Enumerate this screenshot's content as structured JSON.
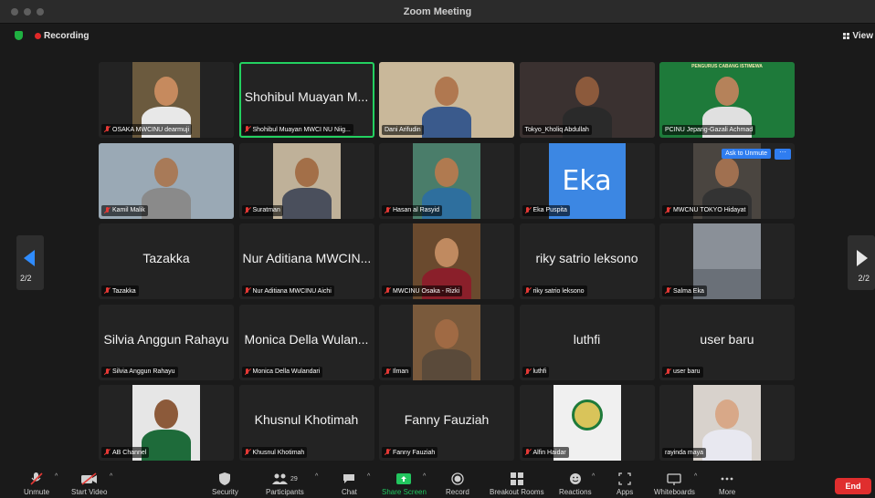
{
  "window": {
    "title": "Zoom Meeting"
  },
  "topbar": {
    "recording_label": "Recording",
    "view_label": "View"
  },
  "pagination": {
    "left": "2/2",
    "right": "2/2"
  },
  "tiles": [
    {
      "big_name": "",
      "label": "OSAKA MWCINU dearmuji",
      "muted": true,
      "video": "person",
      "bg": "#6b5a3e",
      "skin": "#c68a5e",
      "shirt": "#e8e8e8"
    },
    {
      "big_name": "Shohibul Muayan M...",
      "label": "Shohibul Muayan MWCI NU Niig...",
      "muted": true,
      "video": "none",
      "speaking": true
    },
    {
      "big_name": "",
      "label": "Dani Arifudin",
      "muted": false,
      "video": "person-full",
      "bg": "#c9b89a",
      "skin": "#b07850",
      "shirt": "#3a5a8c"
    },
    {
      "big_name": "",
      "label": "Tokyo_Kholiq Abdullah",
      "muted": false,
      "video": "person-full",
      "bg": "#3a3130",
      "skin": "#8c5a3c",
      "shirt": "#2a2a2a"
    },
    {
      "big_name": "",
      "label": "PCINU Jepang-Gazali Achmad",
      "muted": false,
      "video": "person-full",
      "bg": "#1e7a3a",
      "skin": "#b5825a",
      "shirt": "#e0e0e0",
      "banner": "PENGURUS CABANG ISTIMEWA"
    },
    {
      "big_name": "",
      "label": "Kamil Malik",
      "muted": true,
      "video": "person-full",
      "bg": "#9aa9b5",
      "skin": "#a87a58",
      "shirt": "#8a8a8a"
    },
    {
      "big_name": "",
      "label": "Suratman",
      "muted": true,
      "video": "person",
      "bg": "#bfb199",
      "skin": "#a36f48",
      "shirt": "#4a4f5c"
    },
    {
      "big_name": "",
      "label": "Hasan al Rasyid",
      "muted": true,
      "video": "person",
      "bg": "#4a7d6a",
      "skin": "#b07a50",
      "shirt": "#2e6f9e"
    },
    {
      "big_name": "",
      "label": "Eka Puspita",
      "muted": true,
      "video": "eka",
      "eka_text": "Eka"
    },
    {
      "big_name": "",
      "label": "MWCNU TOKYO Hidayat",
      "muted": true,
      "video": "person",
      "bg": "#4a4540",
      "skin": "#a07050",
      "shirt": "#333333",
      "ask_unmute": "Ask to Unmute",
      "more": "···"
    },
    {
      "big_name": "Tazakka",
      "label": "Tazakka",
      "muted": true,
      "video": "none"
    },
    {
      "big_name": "Nur Aditiana MWCIN...",
      "label": "Nur Aditiana MWCINU Aichi",
      "muted": true,
      "video": "none"
    },
    {
      "big_name": "",
      "label": "MWCINU Osaka - Rizki",
      "muted": true,
      "video": "person",
      "bg": "#6a4a2e",
      "skin": "#c08a60",
      "shirt": "#8a1f2a"
    },
    {
      "big_name": "riky satrio leksono",
      "label": "riky satrio leksono",
      "muted": true,
      "video": "none"
    },
    {
      "big_name": "",
      "label": "Salma Eka",
      "muted": true,
      "video": "scene",
      "bg": "#8a9098"
    },
    {
      "big_name": "Silvia Anggun Rahayu",
      "label": "Silvia Anggun Rahayu",
      "muted": true,
      "video": "none"
    },
    {
      "big_name": "Monica Della Wulan...",
      "label": "Monica Della Wulandari",
      "muted": true,
      "video": "none"
    },
    {
      "big_name": "",
      "label": "Ilman",
      "muted": true,
      "video": "person",
      "bg": "#7a5a3c",
      "skin": "#a06a44",
      "shirt": "#5a4a3a"
    },
    {
      "big_name": "luthfi",
      "label": "luthfi",
      "muted": true,
      "video": "none"
    },
    {
      "big_name": "user baru",
      "label": "user baru",
      "muted": true,
      "video": "none"
    },
    {
      "big_name": "",
      "label": "AB Channel",
      "muted": true,
      "video": "person",
      "bg": "#e6e6e6",
      "skin": "#8c5a3a",
      "shirt": "#1e6b3a"
    },
    {
      "big_name": "Khusnul Khotimah",
      "label": "Khusnul Khotimah",
      "muted": true,
      "video": "none"
    },
    {
      "big_name": "Fanny Fauziah",
      "label": "Fanny Fauziah",
      "muted": true,
      "video": "none"
    },
    {
      "big_name": "",
      "label": "Alfin Haidar",
      "muted": true,
      "video": "logo",
      "bg": "#f0f0f0"
    },
    {
      "big_name": "",
      "label": "rayinda maya",
      "muted": false,
      "video": "person",
      "bg": "#d8d2cc",
      "skin": "#d8a888",
      "shirt": "#e8e8f0"
    }
  ],
  "toolbar": {
    "unmute": "Unmute",
    "start_video": "Start Video",
    "security": "Security",
    "participants": "Participants",
    "participants_count": "29",
    "chat": "Chat",
    "share_screen": "Share Screen",
    "record": "Record",
    "breakout_rooms": "Breakout Rooms",
    "reactions": "Reactions",
    "apps": "Apps",
    "whiteboards": "Whiteboards",
    "more": "More",
    "end": "End"
  },
  "colors": {
    "accent": "#2f8cff",
    "end": "#e02e2e",
    "share": "#22c55e",
    "speaking": "#23d160",
    "muted": "#e53935"
  }
}
